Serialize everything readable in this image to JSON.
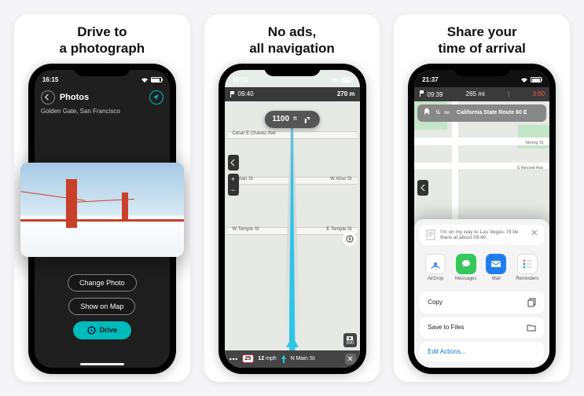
{
  "cards": {
    "c1": {
      "title": "Drive to\na photograph"
    },
    "c2": {
      "title": "No ads,\nall navigation"
    },
    "c3": {
      "title": "Share your\ntime of arrival"
    }
  },
  "phone1": {
    "time": "16:15",
    "screen_title": "Photos",
    "location_name": "Golden Gate, San Francisco",
    "btn_change": "Change Photo",
    "btn_show": "Show on Map",
    "btn_drive": "Drive"
  },
  "phone2": {
    "time": "16:15",
    "top_time": "09:40",
    "top_dist": "270 m",
    "direction_dist": "1100",
    "direction_unit": "ft",
    "street1": "Cesar E Chavez Ave",
    "street2l": "N Main St",
    "street2r": "W Aliso St",
    "street3l": "W Temple St",
    "street3r": "E Temple St",
    "speed_limit": "25",
    "current_speed": "12",
    "speed_unit": "mph",
    "bottom_street": "N Main St",
    "soon_badge": "500"
  },
  "phone3": {
    "time": "21:37",
    "top_dist": "265 mi",
    "top_time": "09:39",
    "eta": "3:00",
    "dir_dist": "½",
    "dir_unit": "mi",
    "dir_road": "California State Route 60 E",
    "share_text": "I'm on my way to Las Vegas. I'll be there at about 09:40.",
    "app1": "AirDrop",
    "app2": "Messages",
    "app3": "Mail",
    "app4": "Reminders",
    "opt_copy": "Copy",
    "opt_save": "Save to Files",
    "opt_edit": "Edit Actions...",
    "street_a": "Strong St",
    "street_b": "S Record Ave"
  }
}
